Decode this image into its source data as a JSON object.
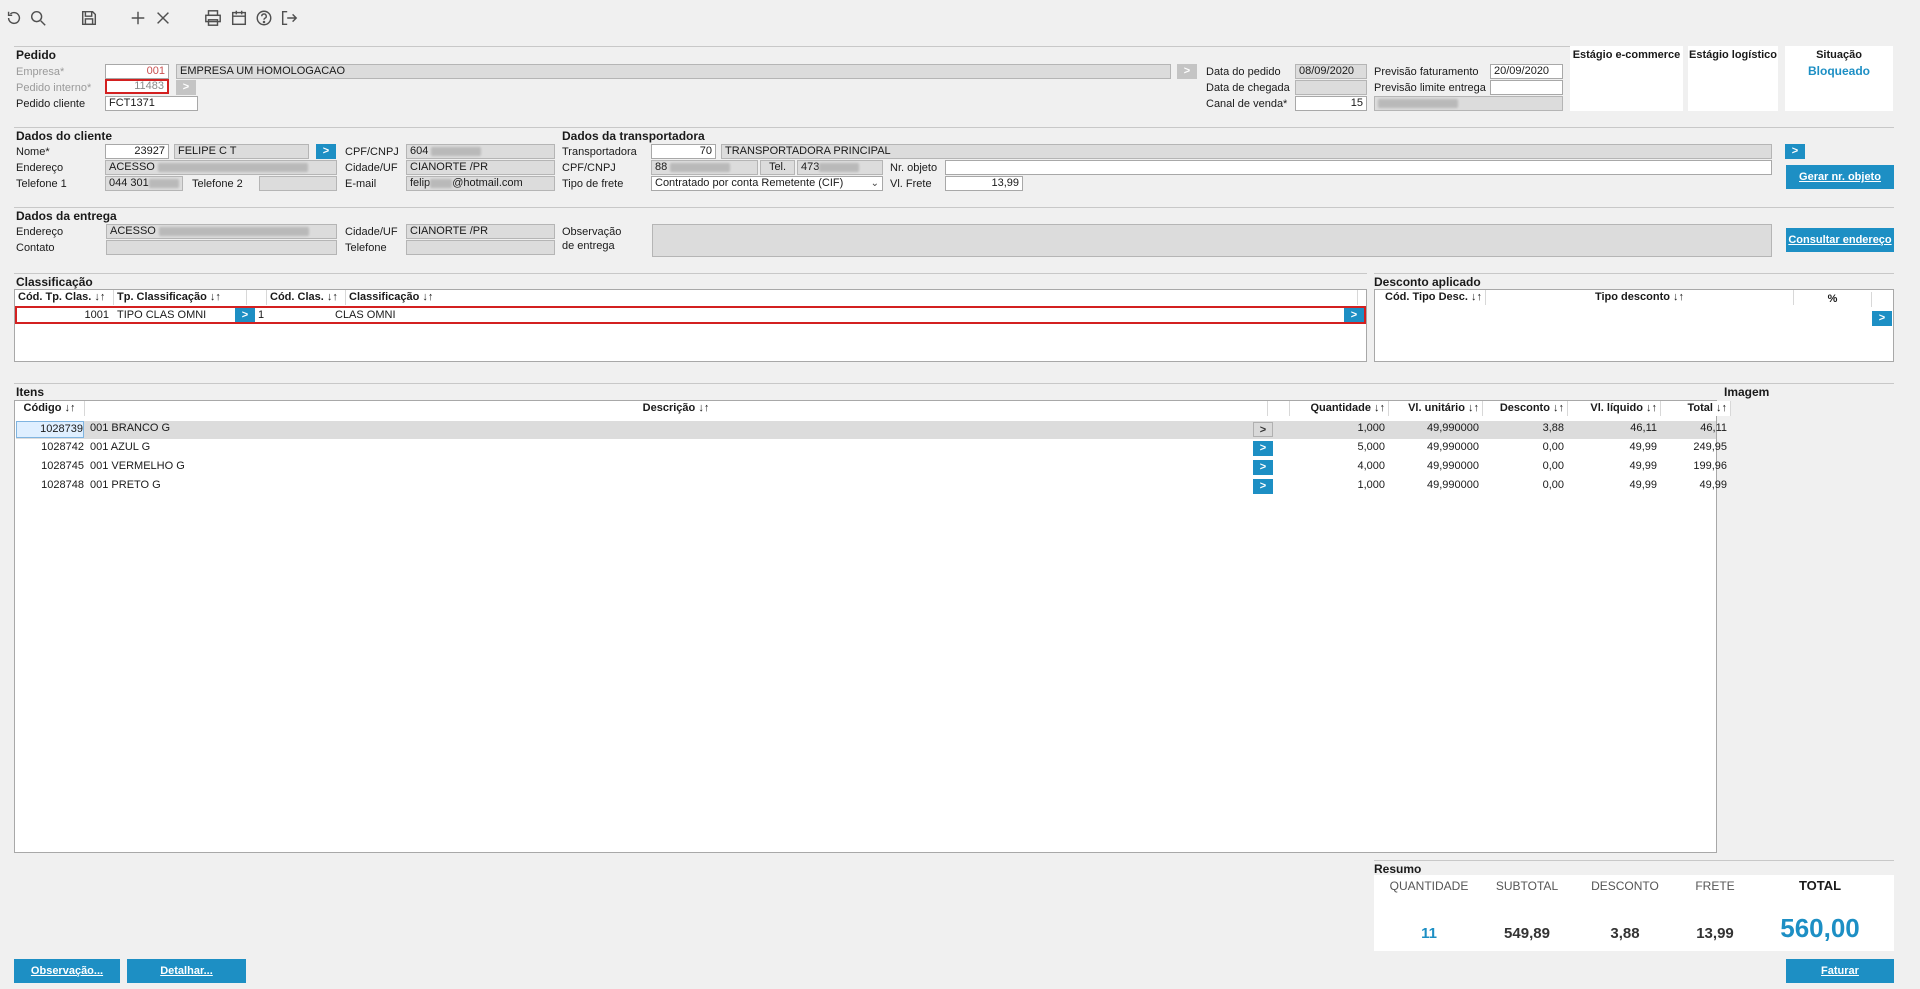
{
  "toolbar": {
    "icons": [
      "refresh-icon",
      "search-icon",
      "save-icon",
      "add-icon",
      "close-icon",
      "print-icon",
      "calendar-icon",
      "help-icon",
      "exit-icon"
    ]
  },
  "pedido": {
    "title": "Pedido",
    "empresa_label": "Empresa*",
    "empresa_code": "001",
    "empresa_name": "EMPRESA UM HOMOLOGACAO",
    "pedido_interno_label": "Pedido interno*",
    "pedido_interno": "11483",
    "pedido_cliente_label": "Pedido cliente",
    "pedido_cliente": "FCT1371",
    "data_pedido_label": "Data do pedido",
    "data_pedido": "08/09/2020",
    "data_chegada_label": "Data de chegada",
    "data_chegada": "",
    "canal_label": "Canal de venda*",
    "canal": "15",
    "previsao_fat_label": "Previsão faturamento",
    "previsao_fat": "20/09/2020",
    "previsao_limite_label": "Previsão limite entrega",
    "previsao_limite": ""
  },
  "stages": {
    "ecommerce_title": "Estágio e-commerce",
    "logistico_title": "Estágio logístico",
    "situacao_title": "Situação",
    "situacao_value": "Bloqueado"
  },
  "cliente": {
    "title": "Dados do cliente",
    "nome_label": "Nome*",
    "nome_code": "23927",
    "nome": "FELIPE C T",
    "endereco_label": "Endereço",
    "endereco": "ACESSO",
    "telefone1_label": "Telefone 1",
    "telefone1": "044 301",
    "telefone2_label": "Telefone 2",
    "cpf_label": "CPF/CNPJ",
    "cpf": "604",
    "cidade_label": "Cidade/UF",
    "cidade": "CIANORTE /PR",
    "email_label": "E-mail",
    "email_prefix": "felip",
    "email_suffix": "@hotmail.com"
  },
  "transportadora": {
    "title": "Dados da transportadora",
    "transp_label": "Transportadora",
    "transp_code": "70",
    "transp_name": "TRANSPORTADORA PRINCIPAL",
    "cpf_label": "CPF/CNPJ",
    "cpf": "88",
    "tel_label": "Tel.",
    "tel": "473",
    "nr_objeto_label": "Nr. objeto",
    "tipo_frete_label": "Tipo de frete",
    "tipo_frete": "Contratado por conta Remetente (CIF)",
    "vl_frete_label": "Vl. Frete",
    "vl_frete": "13,99",
    "gerar_btn": "Gerar nr. objeto"
  },
  "entrega": {
    "title": "Dados da entrega",
    "endereco_label": "Endereço",
    "endereco": "ACESSO",
    "contato_label": "Contato",
    "cidade_label": "Cidade/UF",
    "cidade": "CIANORTE /PR",
    "telefone_label": "Telefone",
    "obs_label1": "Observação",
    "obs_label2": "de entrega",
    "consultar_btn": "Consultar endereço"
  },
  "classificacao": {
    "title": "Classificação",
    "headers": [
      "Cód. Tp. Clas. ↓↑",
      "Tp. Classificação ↓↑",
      "Cód. Clas. ↓↑",
      "Classificação ↓↑"
    ],
    "row": {
      "cod_tp": "1001",
      "tp": "TIPO CLAS OMNI",
      "cod": "1",
      "clas": "CLAS OMNI"
    }
  },
  "desconto": {
    "title": "Desconto aplicado",
    "headers": [
      "Cód. Tipo Desc. ↓↑",
      "Tipo desconto ↓↑",
      "%"
    ]
  },
  "itens": {
    "title": "Itens",
    "imagem_label": "Imagem",
    "headers": [
      "Código ↓↑",
      "Descrição ↓↑",
      "Quantidade ↓↑",
      "Vl. unitário ↓↑",
      "Desconto ↓↑",
      "Vl. líquido ↓↑",
      "Total ↓↑"
    ],
    "rows": [
      {
        "codigo": "1028739",
        "descricao": "001 BRANCO G",
        "qtd": "1,000",
        "unit": "49,990000",
        "desc": "3,88",
        "liq": "46,11",
        "total": "46,11"
      },
      {
        "codigo": "1028742",
        "descricao": "001 AZUL G",
        "qtd": "5,000",
        "unit": "49,990000",
        "desc": "0,00",
        "liq": "49,99",
        "total": "249,95"
      },
      {
        "codigo": "1028745",
        "descricao": "001 VERMELHO G",
        "qtd": "4,000",
        "unit": "49,990000",
        "desc": "0,00",
        "liq": "49,99",
        "total": "199,96"
      },
      {
        "codigo": "1028748",
        "descricao": "001 PRETO G",
        "qtd": "1,000",
        "unit": "49,990000",
        "desc": "0,00",
        "liq": "49,99",
        "total": "49,99"
      }
    ]
  },
  "resumo": {
    "title": "Resumo",
    "quantidade_label": "QUANTIDADE",
    "subtotal_label": "SUBTOTAL",
    "desconto_label": "DESCONTO",
    "frete_label": "FRETE",
    "total_label": "TOTAL",
    "quantidade": "11",
    "subtotal": "549,89",
    "desconto": "3,88",
    "frete": "13,99",
    "total": "560,00"
  },
  "footer": {
    "observacao_btn": "Observação...",
    "detalhar_btn": "Detalhar...",
    "faturar_btn": "Faturar"
  },
  "colors": {
    "accent": "#1d8fc4",
    "error": "#d32020"
  }
}
